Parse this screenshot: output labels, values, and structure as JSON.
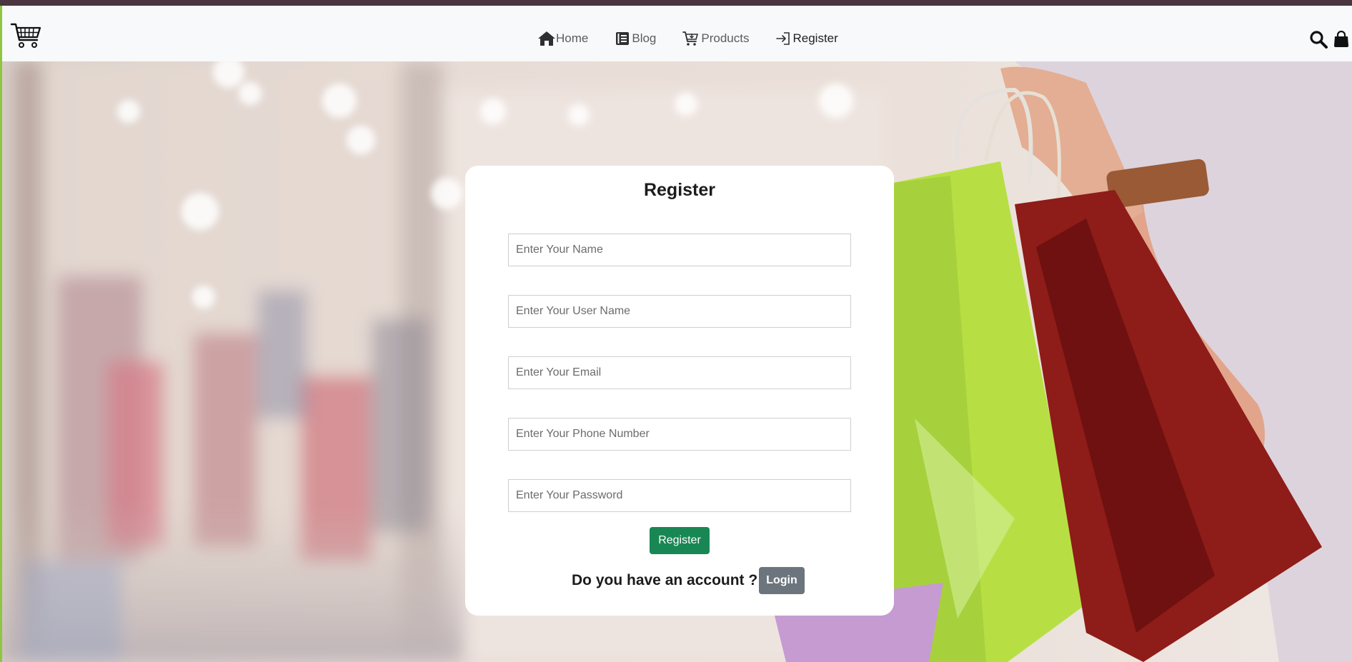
{
  "nav": {
    "logo_icon": "shopping-cart-icon",
    "links": [
      {
        "label": "Home",
        "icon": "home-icon"
      },
      {
        "label": "Blog",
        "icon": "blog-icon"
      },
      {
        "label": "Products",
        "icon": "cart-icon"
      },
      {
        "label": "Register",
        "icon": "sign-in-icon"
      }
    ],
    "right_icons": [
      "search-icon",
      "shopping-bag-icon"
    ]
  },
  "form": {
    "title": "Register",
    "fields": [
      {
        "placeholder": "Enter Your Name",
        "value": ""
      },
      {
        "placeholder": "Enter Your User Name",
        "value": ""
      },
      {
        "placeholder": "Enter Your Email",
        "value": ""
      },
      {
        "placeholder": "Enter Your Phone Number",
        "value": ""
      },
      {
        "placeholder": "Enter Your Password",
        "value": ""
      }
    ],
    "submit_label": "Register",
    "login_prompt": "Do you have an account ?",
    "login_label": "Login"
  },
  "colors": {
    "top_strip": "#4a3540",
    "navbar_bg": "#f8f9fa",
    "submit_bg": "#198754",
    "login_bg": "#6c757d",
    "accent_edge": "#8ec63f"
  }
}
